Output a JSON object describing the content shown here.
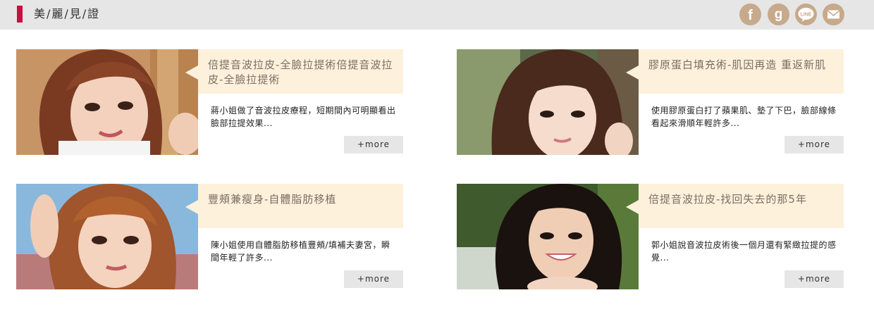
{
  "header": {
    "title": "美/麗/見/證",
    "accent_color": "#c8103e",
    "social": [
      {
        "name": "facebook-icon",
        "glyph": "f"
      },
      {
        "name": "google-icon",
        "glyph": "g"
      },
      {
        "name": "line-icon",
        "glyph": "LINE"
      },
      {
        "name": "mail-icon",
        "glyph": "✉"
      }
    ],
    "social_color": "#c7a98b"
  },
  "cards": [
    {
      "title": "倍提音波拉皮-全臉拉提術倍提音波拉皮-全臉拉提術",
      "description": "蔣小姐做了音波拉皮療程，短期間內可明顯看出臉部拉提效果...",
      "more_label": "+more"
    },
    {
      "title": "膠原蛋白填充術-肌因再造 重返新肌",
      "description": "使用膠原蛋白打了蘋果肌、墊了下巴，臉部線條看起來滑順年輕許多...",
      "more_label": "+more"
    },
    {
      "title": "豐頰兼瘦身-自體脂肪移植",
      "description": "陳小姐使用自體脂肪移植豐頰/填補夫妻宮，瞬間年輕了許多...",
      "more_label": "+more"
    },
    {
      "title": "倍提音波拉皮-找回失去的那5年",
      "description": "郭小姐說音波拉皮術後一個月還有緊緻拉提的感覺...",
      "more_label": "+more"
    }
  ]
}
